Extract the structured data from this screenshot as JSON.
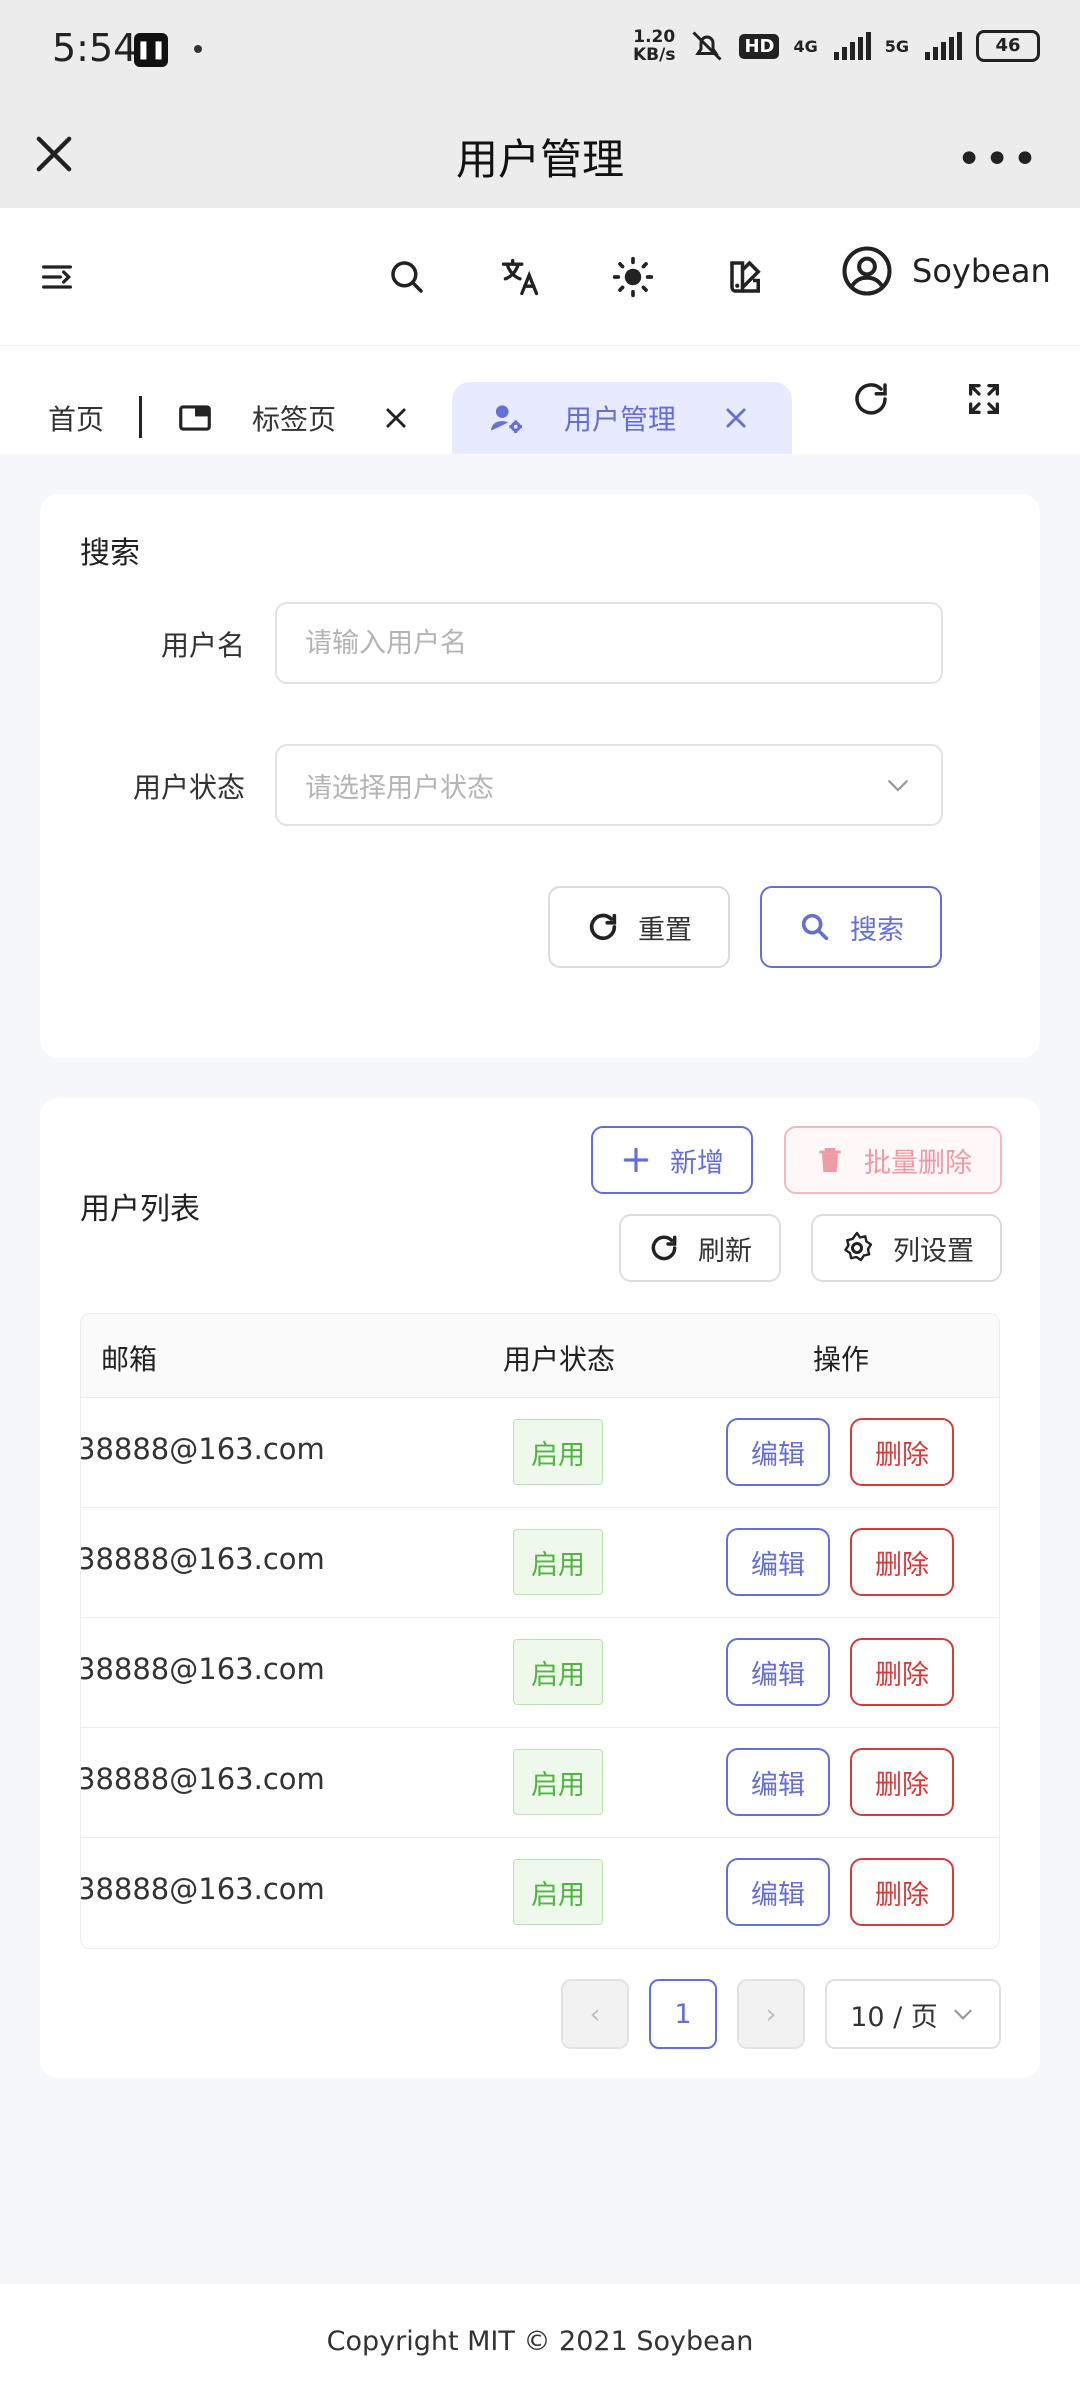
{
  "status_bar": {
    "time": "5:54",
    "net_speed_value": "1.20",
    "net_speed_unit": "KB/s",
    "hd": "HD",
    "signal_1": "4G",
    "signal_2": "5G",
    "battery": "46"
  },
  "window": {
    "title": "用户管理"
  },
  "header": {
    "username": "Soybean"
  },
  "tabs": [
    {
      "label": "首页"
    },
    {
      "label": "标签页"
    },
    {
      "label": "用户管理"
    }
  ],
  "search_card": {
    "title": "搜索",
    "username_label": "用户名",
    "username_placeholder": "请输入用户名",
    "status_label": "用户状态",
    "status_placeholder": "请选择用户状态",
    "reset_label": "重置",
    "search_label": "搜索"
  },
  "list_card": {
    "title": "用户列表",
    "add_label": "新增",
    "batch_delete_label": "批量删除",
    "refresh_label": "刷新",
    "column_settings_label": "列设置",
    "columns": [
      "邮箱",
      "用户状态",
      "操作"
    ],
    "rows": [
      {
        "email": "38888@163.com",
        "status": "启用",
        "edit": "编辑",
        "delete": "删除"
      },
      {
        "email": "38888@163.com",
        "status": "启用",
        "edit": "编辑",
        "delete": "删除"
      },
      {
        "email": "38888@163.com",
        "status": "启用",
        "edit": "编辑",
        "delete": "删除"
      },
      {
        "email": "38888@163.com",
        "status": "启用",
        "edit": "编辑",
        "delete": "删除"
      },
      {
        "email": "38888@163.com",
        "status": "启用",
        "edit": "编辑",
        "delete": "删除"
      }
    ],
    "pagination": {
      "prev": "‹",
      "current_page": "1",
      "next": "›",
      "page_size": "10 / 页"
    }
  },
  "footer": {
    "text": "Copyright MIT © 2021 Soybean"
  },
  "colors": {
    "primary": "#6470d8",
    "danger": "#d43b3b",
    "success": "#52b442"
  }
}
